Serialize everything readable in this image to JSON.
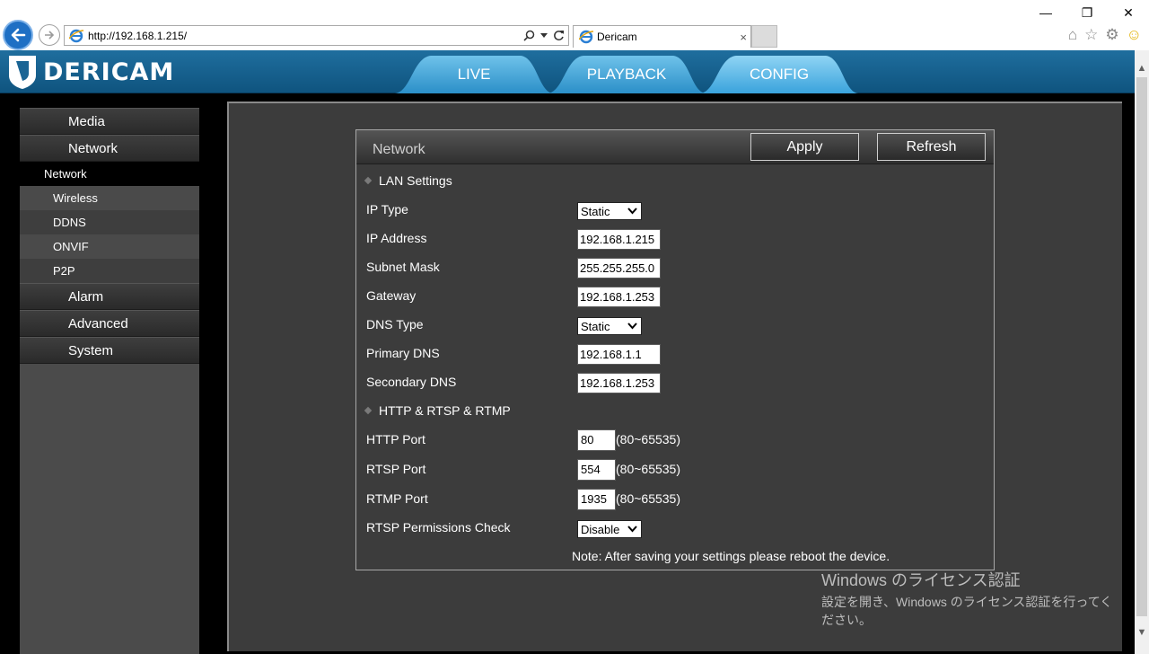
{
  "browser": {
    "url": "http://192.168.1.215/",
    "tab_title": "Dericam",
    "tab_close": "×",
    "window_controls": {
      "minimize": "—",
      "restore": "❐",
      "close": "✕"
    },
    "icons": [
      "home-icon",
      "star-icon",
      "gear-icon",
      "smiley-icon"
    ]
  },
  "header": {
    "brand": "DERICAM",
    "nav": [
      {
        "label": "LIVE"
      },
      {
        "label": "PLAYBACK"
      },
      {
        "label": "CONFIG"
      }
    ]
  },
  "sidebar": {
    "media": "Media",
    "network": "Network",
    "sub_active": "Network",
    "subs": [
      "Wireless",
      "DDNS",
      "ONVIF",
      "P2P"
    ],
    "alarm": "Alarm",
    "advanced": "Advanced",
    "system": "System"
  },
  "panel": {
    "title": "Network",
    "apply": "Apply",
    "refresh": "Refresh",
    "lan_section": "LAN Settings",
    "ip_type_label": "IP Type",
    "ip_type_value": "Static",
    "ip_address_label": "IP Address",
    "ip_address_value": "192.168.1.215",
    "subnet_mask_label": "Subnet Mask",
    "subnet_mask_value": "255.255.255.0",
    "gateway_label": "Gateway",
    "gateway_value": "192.168.1.253",
    "dns_type_label": "DNS Type",
    "dns_type_value": "Static",
    "primary_dns_label": "Primary DNS",
    "primary_dns_value": "192.168.1.1",
    "secondary_dns_label": "Secondary DNS",
    "secondary_dns_value": "192.168.1.253",
    "protocol_section": "HTTP & RTSP & RTMP",
    "http_port_label": "HTTP Port",
    "http_port_value": "80",
    "rtsp_port_label": "RTSP Port",
    "rtsp_port_value": "554",
    "rtmp_port_label": "RTMP Port",
    "rtmp_port_value": "1935",
    "port_range": "(80~65535)",
    "rtsp_check_label": "RTSP Permissions Check",
    "rtsp_check_value": "Disable",
    "note": "Note: After saving your settings please reboot the device."
  },
  "watermark": {
    "title": "Windows のライセンス認証",
    "body": "設定を開き、Windows のライセンス認証を行ってください。"
  }
}
